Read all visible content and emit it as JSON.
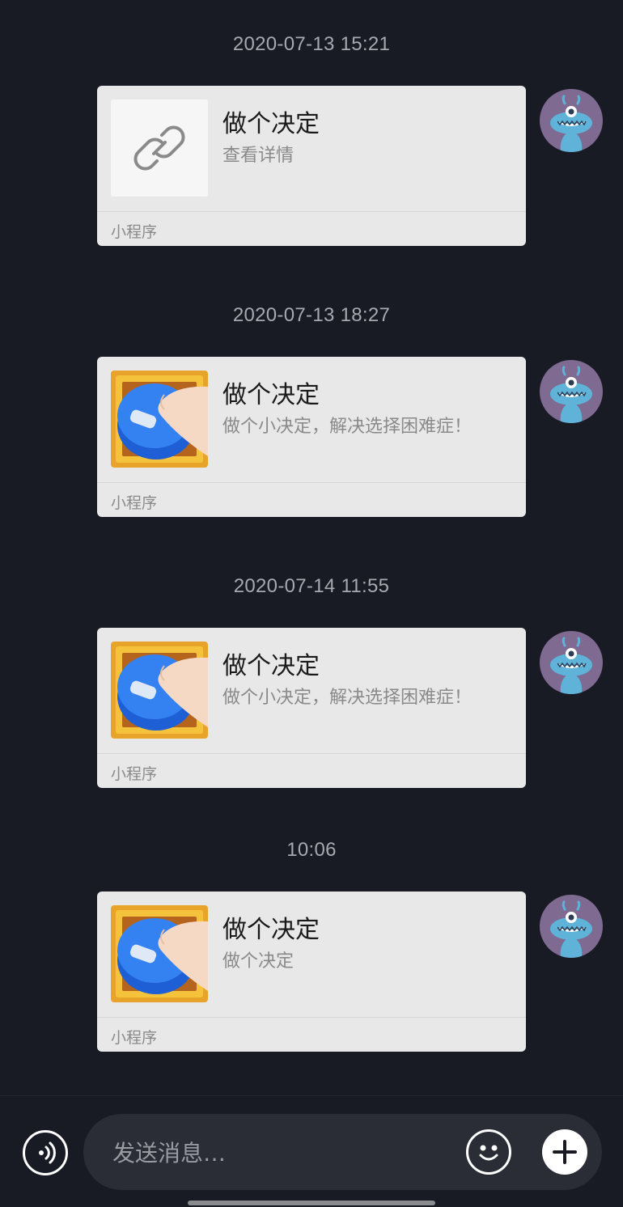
{
  "messages": [
    {
      "timestamp": "2020-07-13 15:21",
      "card": {
        "title": "做个决定",
        "description": "查看详情",
        "source": "小程序",
        "thumbnail_icon": "link-icon"
      }
    },
    {
      "timestamp": "2020-07-13 18:27",
      "card": {
        "title": "做个决定",
        "description": "做个小决定，解决选择困难症！",
        "source": "小程序",
        "thumbnail_icon": "button-press-icon"
      }
    },
    {
      "timestamp": "2020-07-14 11:55",
      "card": {
        "title": "做个决定",
        "description": "做个小决定，解决选择困难症！",
        "source": "小程序",
        "thumbnail_icon": "button-press-icon"
      }
    },
    {
      "timestamp": "10:06",
      "card": {
        "title": "做个决定",
        "description": "做个决定",
        "source": "小程序",
        "thumbnail_icon": "button-press-icon"
      }
    }
  ],
  "input_bar": {
    "placeholder": "发送消息…",
    "voice_icon": "voice-icon",
    "emoji_icon": "emoji-icon",
    "plus_icon": "plus-icon"
  },
  "colors": {
    "background": "#181a24",
    "card": "#e8e8e8",
    "avatar_bg": "#7f6a92",
    "timestamp": "#a7a9b0"
  }
}
